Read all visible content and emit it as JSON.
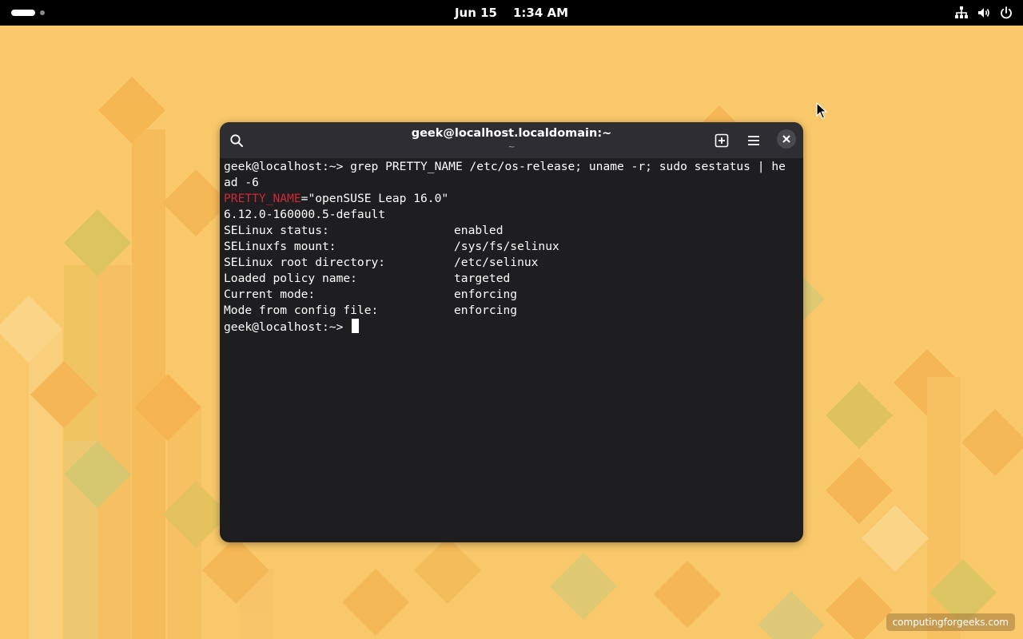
{
  "topbar": {
    "date": "Jun 15",
    "time": "1:34 AM",
    "tray_icons": [
      "network-icon",
      "volume-icon",
      "power-icon"
    ]
  },
  "terminal": {
    "title": "geek@localhost.localdomain:~",
    "subtitle": "~",
    "buttons": [
      "search-icon",
      "new-tab-icon",
      "menu-icon",
      "close-icon"
    ],
    "command_line_1": "geek@localhost:~> grep PRETTY_NAME /etc/os-release; uname -r; sudo sestatus | he",
    "command_line_2": "ad -6",
    "pretty_name_key": "PRETTY_NAME",
    "pretty_name_value": "=\"openSUSE Leap 16.0\"",
    "kernel": "6.12.0-160000.5-default",
    "sestatus": [
      {
        "label": "SELinux status:",
        "value": "enabled"
      },
      {
        "label": "SELinuxfs mount:",
        "value": "/sys/fs/selinux"
      },
      {
        "label": "SELinux root directory:",
        "value": "/etc/selinux"
      },
      {
        "label": "Loaded policy name:",
        "value": "targeted"
      },
      {
        "label": "Current mode:",
        "value": "enforcing"
      },
      {
        "label": "Mode from config file:",
        "value": "enforcing"
      }
    ],
    "prompt": "geek@localhost:~> "
  },
  "watermark": "computingforgeeks.com",
  "colors": {
    "wallpaper": "#f9c86a",
    "terminal_bg": "#1e1e20",
    "headerbar_bg": "#2e2e32",
    "grep_highlight": "#d0263a"
  }
}
